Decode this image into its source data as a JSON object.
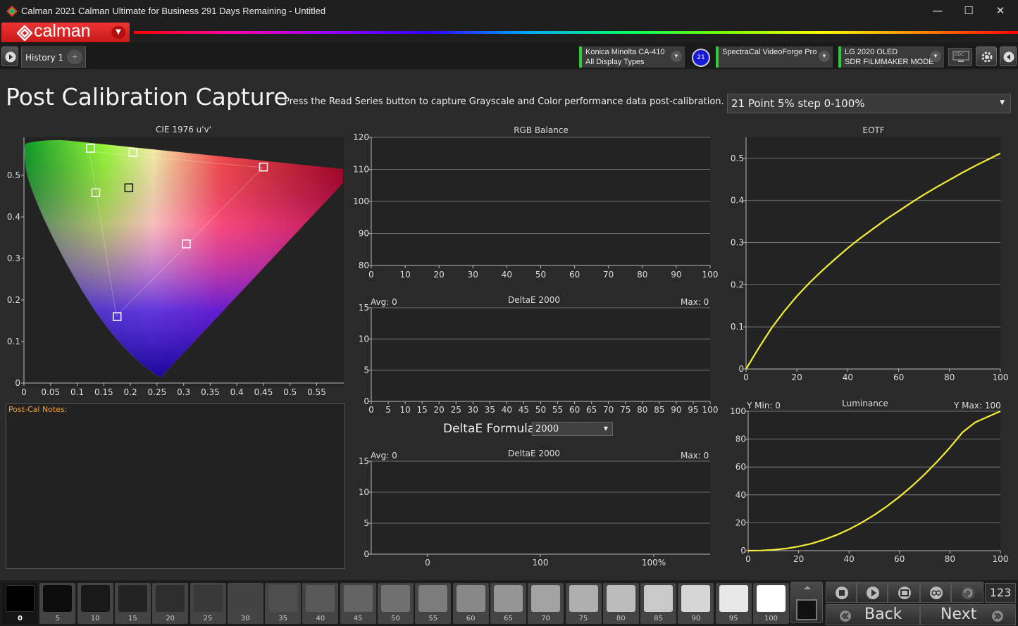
{
  "window": {
    "title": "Calman 2021 Calman Ultimate for Business 291 Days Remaining   -  Untitled",
    "minimize": "—",
    "maximize": "☐",
    "close": "✕"
  },
  "brand": {
    "logo_text": "calman"
  },
  "toolbar": {
    "history_tab": "History 1",
    "add_tab": "+",
    "meter": {
      "line1": "Konica Minolta CA-410",
      "line2": "All Display Types"
    },
    "meter_badge": "21",
    "source": {
      "line1": "SpectraCal VideoForge Pro"
    },
    "display": {
      "line1": "LG 2020 OLED",
      "line2": "SDR FILMMAKER MODE"
    },
    "ddc_label": "DDC"
  },
  "page": {
    "title": "Post Calibration Capture",
    "subtitle": "Press the Read Series button to capture Grayscale and Color performance data post-calibration.",
    "series_select": "21 Point 5% step 0-100%",
    "notes_label": "Post-Cal Notes:",
    "formula_label": "DeltaE Formula",
    "formula_value": "2000"
  },
  "chart_data": [
    {
      "type": "scatter",
      "title": "CIE 1976 u'v'",
      "xlim": [
        0,
        0.6
      ],
      "ylim": [
        0,
        0.6
      ],
      "x_ticks": [
        "0",
        "0.05",
        "0.1",
        "0.15",
        "0.2",
        "0.25",
        "0.3",
        "0.35",
        "0.4",
        "0.45",
        "0.5",
        "0.55"
      ],
      "y_ticks": [
        "0",
        "0.1",
        "0.2",
        "0.3",
        "0.4",
        "0.5"
      ],
      "points": [
        {
          "u": 0.125,
          "v": 0.565
        },
        {
          "u": 0.205,
          "v": 0.555
        },
        {
          "u": 0.45,
          "v": 0.52
        },
        {
          "u": 0.135,
          "v": 0.458
        },
        {
          "u": 0.197,
          "v": 0.47
        },
        {
          "u": 0.305,
          "v": 0.335
        },
        {
          "u": 0.175,
          "v": 0.16
        }
      ]
    },
    {
      "type": "line",
      "title": "RGB Balance",
      "xlim": [
        0,
        100
      ],
      "ylim": [
        80,
        120
      ],
      "x_ticks": [
        "0",
        "10",
        "20",
        "30",
        "40",
        "50",
        "60",
        "70",
        "80",
        "90",
        "100"
      ],
      "y_ticks": [
        "80",
        "90",
        "100",
        "110",
        "120"
      ]
    },
    {
      "type": "bar",
      "title": "DeltaE 2000",
      "avg": "Avg: 0",
      "max": "Max: 0",
      "ylim": [
        0,
        15
      ],
      "x_ticks": [
        "0",
        "5",
        "10",
        "15",
        "20",
        "25",
        "30",
        "35",
        "40",
        "45",
        "50",
        "55",
        "60",
        "65",
        "70",
        "75",
        "80",
        "85",
        "90",
        "95",
        "100"
      ],
      "y_ticks": [
        "0",
        "5",
        "10",
        "15"
      ]
    },
    {
      "type": "bar",
      "title": "DeltaE 2000",
      "avg": "Avg: 0",
      "max": "Max: 0",
      "ylim": [
        0,
        15
      ],
      "x_ticks": [
        "0",
        "100",
        "100%"
      ],
      "y_ticks": [
        "0",
        "5",
        "10",
        "15"
      ]
    },
    {
      "type": "line",
      "title": "EOTF",
      "xlim": [
        0,
        100
      ],
      "ylim": [
        0,
        0.55
      ],
      "x_ticks": [
        "0",
        "20",
        "40",
        "60",
        "80",
        "100"
      ],
      "y_ticks": [
        "0",
        "0.1",
        "0.2",
        "0.3",
        "0.4",
        "0.5"
      ],
      "series": [
        {
          "color": "#f5ee38",
          "x": [
            0,
            5,
            10,
            15,
            20,
            25,
            30,
            35,
            40,
            45,
            50,
            55,
            60,
            65,
            70,
            75,
            80,
            85,
            90,
            95,
            100
          ],
          "y": [
            0,
            0.05,
            0.097,
            0.137,
            0.173,
            0.205,
            0.234,
            0.261,
            0.287,
            0.311,
            0.333,
            0.355,
            0.375,
            0.395,
            0.414,
            0.432,
            0.449,
            0.466,
            0.482,
            0.497,
            0.512
          ]
        }
      ]
    },
    {
      "type": "line",
      "title": "Luminance",
      "ymin_label": "Y Min: 0",
      "ymax_label": "Y Max: 100",
      "xlim": [
        0,
        100
      ],
      "ylim": [
        0,
        100
      ],
      "x_ticks": [
        "0",
        "20",
        "40",
        "60",
        "80",
        "100"
      ],
      "y_ticks": [
        "0",
        "20",
        "40",
        "60",
        "80",
        "100"
      ],
      "series": [
        {
          "color": "#f5ee38",
          "x": [
            0,
            5,
            10,
            15,
            20,
            25,
            30,
            35,
            40,
            45,
            50,
            55,
            60,
            65,
            70,
            75,
            80,
            85,
            90,
            95,
            100
          ],
          "y": [
            0,
            0.1,
            0.6,
            1.5,
            3,
            5,
            7.8,
            11.2,
            15.3,
            20.1,
            25.6,
            31.8,
            38.7,
            46.4,
            54.8,
            64,
            74,
            84.9,
            92,
            96,
            100
          ]
        }
      ]
    }
  ],
  "patches": [
    {
      "label": "0",
      "color": "#000000"
    },
    {
      "label": "5",
      "color": "#0c0c0c"
    },
    {
      "label": "10",
      "color": "#181818"
    },
    {
      "label": "15",
      "color": "#232323"
    },
    {
      "label": "20",
      "color": "#2e2e2e"
    },
    {
      "label": "25",
      "color": "#383838"
    },
    {
      "label": "30",
      "color": "#434343"
    },
    {
      "label": "35",
      "color": "#4e4e4e"
    },
    {
      "label": "40",
      "color": "#595959"
    },
    {
      "label": "45",
      "color": "#646464"
    },
    {
      "label": "50",
      "color": "#707070"
    },
    {
      "label": "55",
      "color": "#7c7c7c"
    },
    {
      "label": "60",
      "color": "#888888"
    },
    {
      "label": "65",
      "color": "#959595"
    },
    {
      "label": "70",
      "color": "#a2a2a2"
    },
    {
      "label": "75",
      "color": "#afafaf"
    },
    {
      "label": "80",
      "color": "#bcbcbc"
    },
    {
      "label": "85",
      "color": "#c9c9c9"
    },
    {
      "label": "90",
      "color": "#d6d6d6"
    },
    {
      "label": "95",
      "color": "#e8e8e8"
    },
    {
      "label": "100",
      "color": "#ffffff"
    }
  ],
  "controls": {
    "counter": "123",
    "back": "Back",
    "next": "Next"
  }
}
